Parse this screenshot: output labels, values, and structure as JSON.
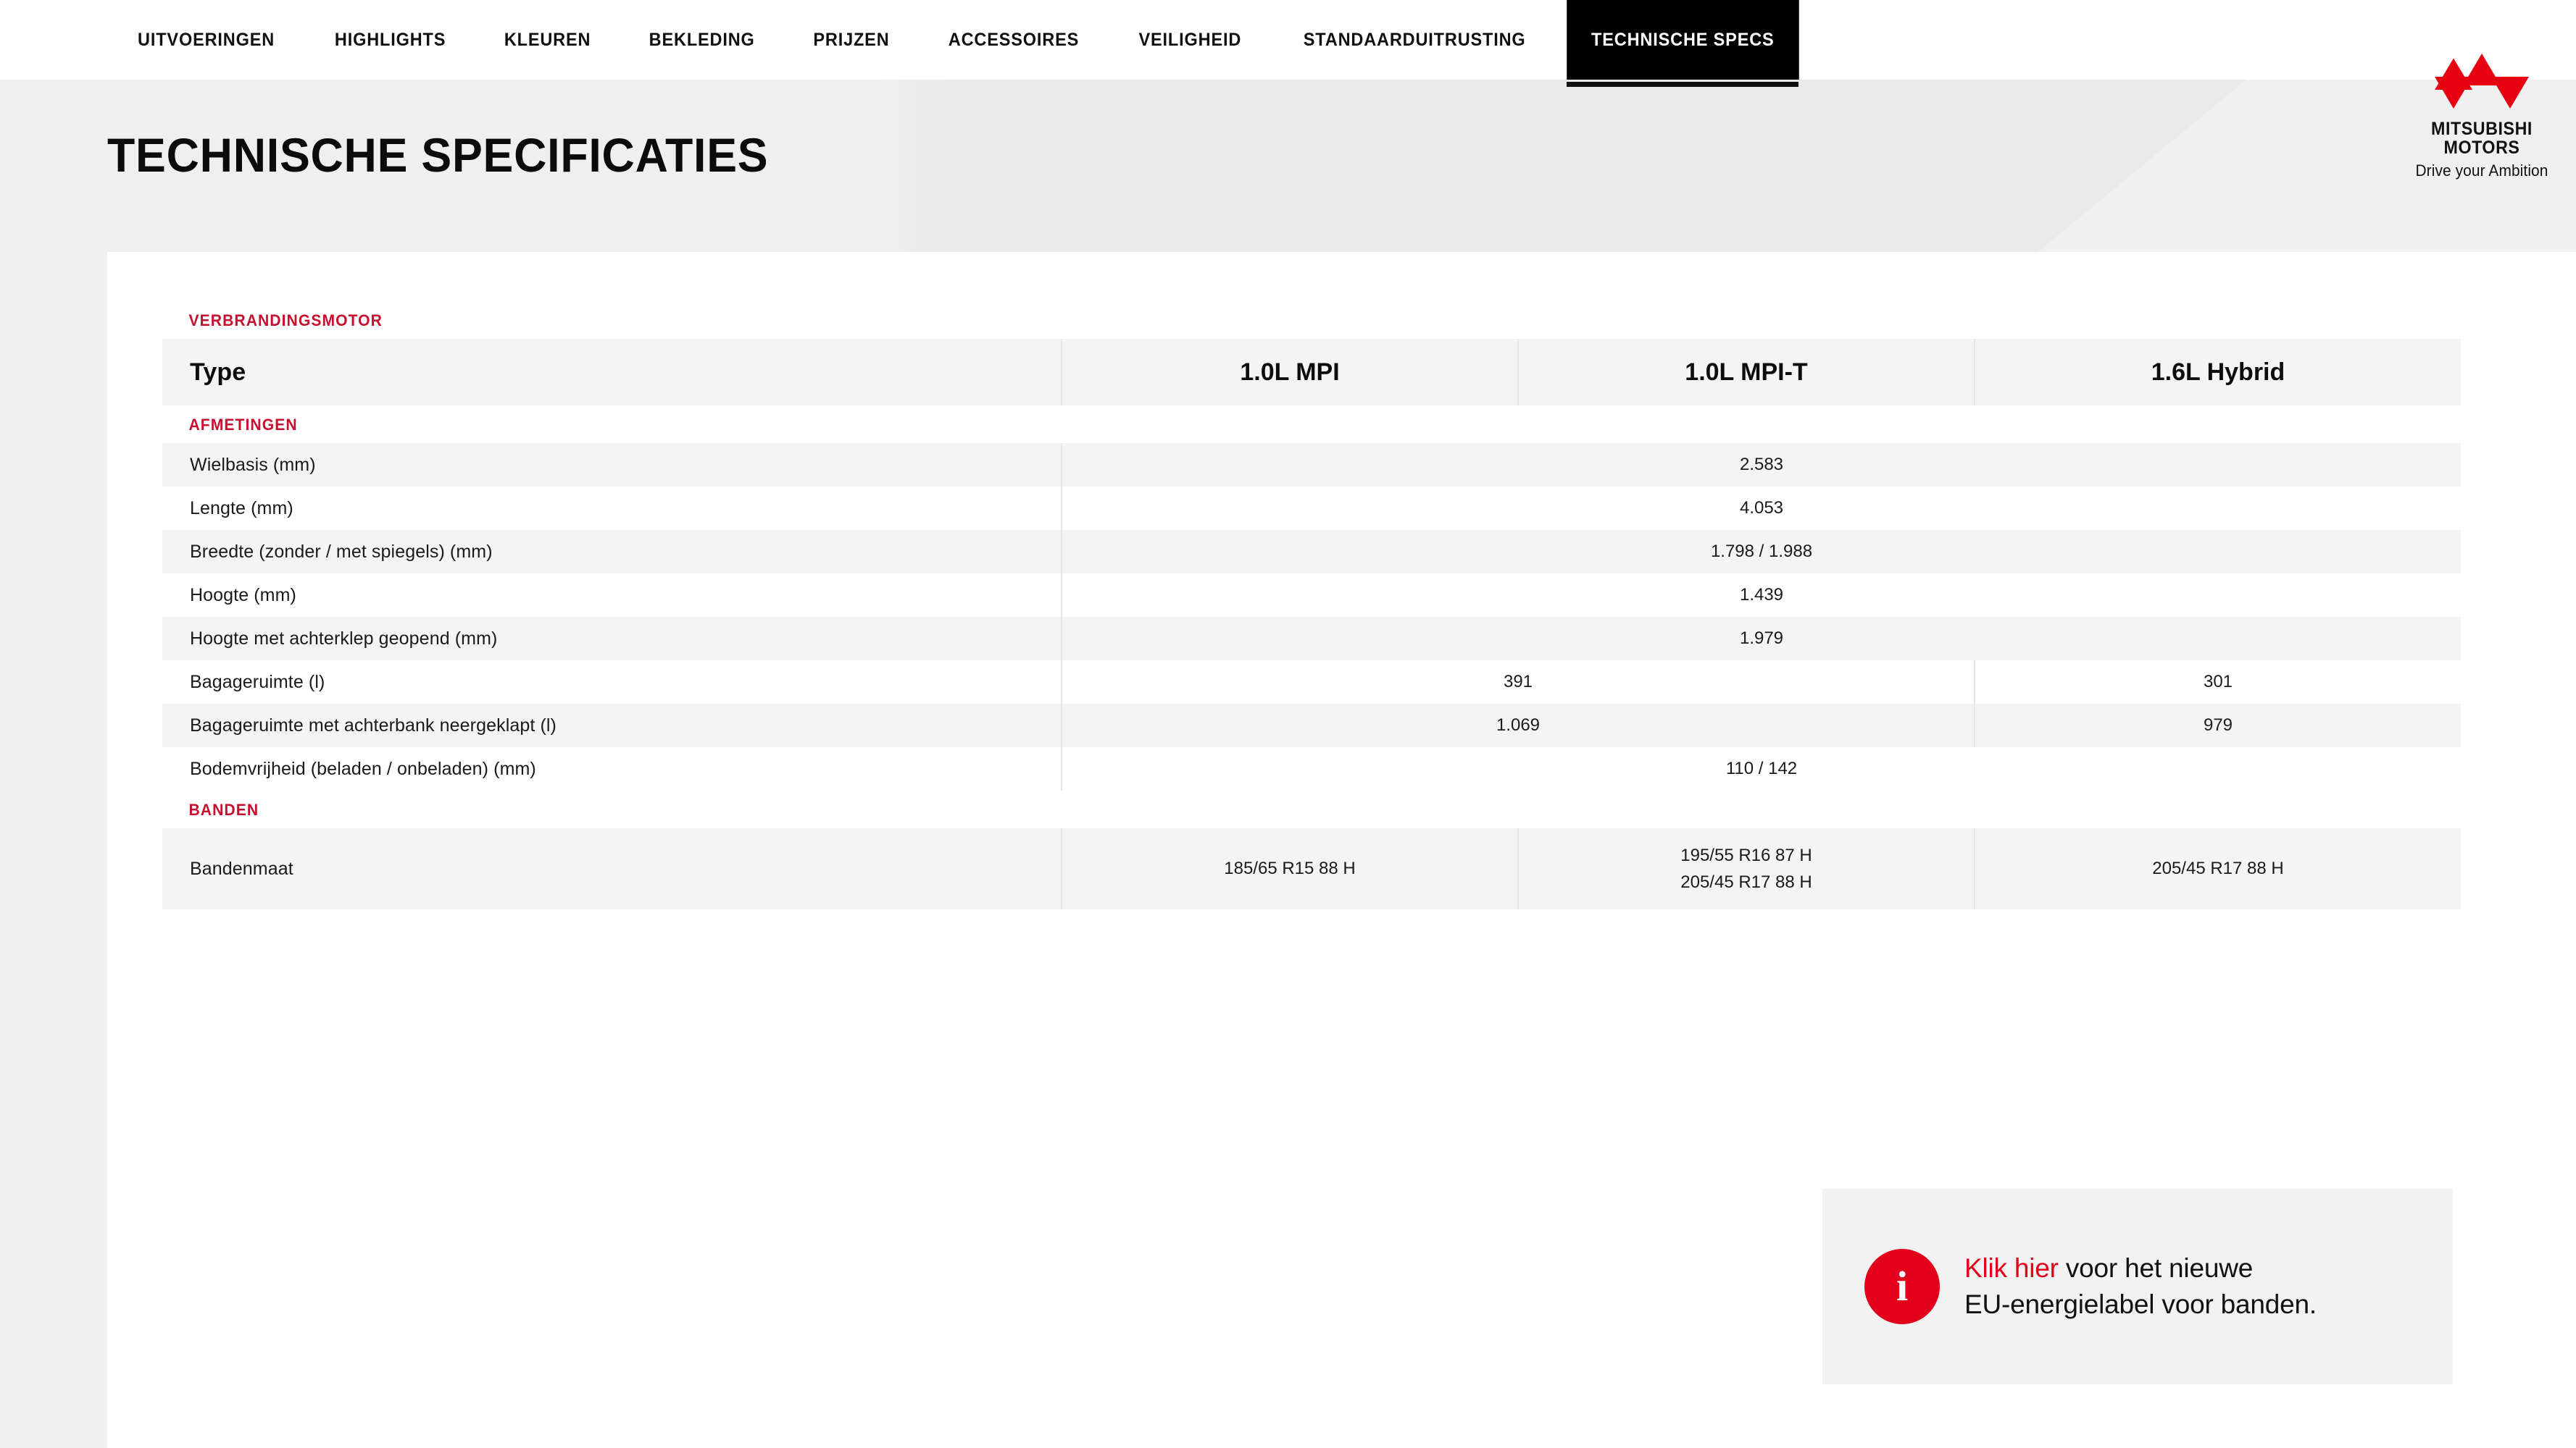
{
  "nav": {
    "items": [
      {
        "label": "UITVOERINGEN",
        "active": false
      },
      {
        "label": "HIGHLIGHTS",
        "active": false
      },
      {
        "label": "KLEUREN",
        "active": false
      },
      {
        "label": "BEKLEDING",
        "active": false
      },
      {
        "label": "PRIJZEN",
        "active": false
      },
      {
        "label": "ACCESSOIRES",
        "active": false
      },
      {
        "label": "VEILIGHEID",
        "active": false
      },
      {
        "label": "STANDAARDUITRUSTING",
        "active": false
      },
      {
        "label": "TECHNISCHE SPECS",
        "active": true
      }
    ]
  },
  "header": {
    "title": "TECHNISCHE SPECIFICATIES"
  },
  "logo": {
    "name_line1": "MITSUBISHI",
    "name_line2": "MOTORS",
    "tagline": "Drive your Ambition",
    "mark_color": "#E60012"
  },
  "colors": {
    "accent_red": "#C8102E",
    "info_red": "#E2001A",
    "row_shade": "#F4F4F4",
    "active_tab_bg": "#000000"
  },
  "table": {
    "groups": [
      {
        "title": "VERBRANDINGSMOTOR"
      },
      {
        "title": "AFMETINGEN"
      },
      {
        "title": "BANDEN"
      }
    ],
    "header": {
      "label": "Type",
      "columns": [
        "1.0L MPI",
        "1.0L MPI-T",
        "1.6L Hybrid"
      ]
    },
    "rows": [
      {
        "label": "Wielbasis (mm)",
        "span": 3,
        "values": [
          "2.583"
        ]
      },
      {
        "label": "Lengte (mm)",
        "span": 3,
        "values": [
          "4.053"
        ]
      },
      {
        "label": "Breedte (zonder / met spiegels) (mm)",
        "span": 3,
        "values": [
          "1.798 / 1.988"
        ]
      },
      {
        "label": "Hoogte (mm)",
        "span": 3,
        "values": [
          "1.439"
        ]
      },
      {
        "label": "Hoogte met achterklep geopend (mm)",
        "span": 3,
        "values": [
          "1.979"
        ]
      },
      {
        "label": "Bagageruimte (l)",
        "span": "2+1",
        "values": [
          "391",
          "301"
        ]
      },
      {
        "label": "Bagageruimte met achterbank neergeklapt (l)",
        "span": "2+1",
        "values": [
          "1.069",
          "979"
        ]
      },
      {
        "label": "Bodemvrijheid (beladen / onbeladen) (mm)",
        "span": 3,
        "values": [
          "110 / 142"
        ]
      }
    ],
    "tire_row": {
      "label": "Bandenmaat",
      "values": [
        "185/65 R15 88 H",
        "195/55 R16 87 H\n205/45 R17 88 H",
        "205/45 R17 88 H"
      ]
    }
  },
  "info_box": {
    "icon_glyph": "i",
    "link_text": "Klik hier",
    "text_line1_rest": " voor het nieuwe",
    "text_line2": "EU-energielabel voor banden."
  }
}
